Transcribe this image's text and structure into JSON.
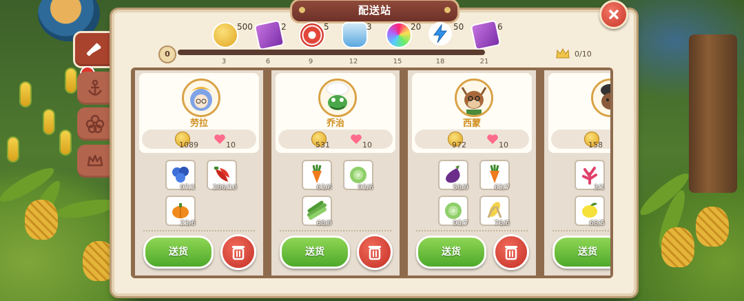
{
  "title": "配送站",
  "rewards": [
    {
      "icon": "gold-coin-icon",
      "count": "500",
      "tick": "3"
    },
    {
      "icon": "purple-ticket-icon",
      "count": "2",
      "tick": "6"
    },
    {
      "icon": "red-chip-icon",
      "count": "5",
      "tick": "9"
    },
    {
      "icon": "potion-bottle-icon",
      "count": "3",
      "tick": "12"
    },
    {
      "icon": "rainbow-orb-icon",
      "count": "20",
      "tick": "15"
    },
    {
      "icon": "lightning-icon",
      "count": "50",
      "tick": "18"
    },
    {
      "icon": "purple-ticket-icon",
      "count": "6",
      "tick": "21"
    }
  ],
  "progress": {
    "start": "0",
    "crown_progress": "0/10"
  },
  "customers": [
    {
      "name": "劳拉",
      "coins": "1089",
      "hearts": "10",
      "items": [
        {
          "icon": "blueberry-icon",
          "qty": "97/1"
        },
        {
          "icon": "chili-pepper-icon",
          "qty": "286/10"
        },
        {
          "icon": "pumpkin-icon",
          "qty": "23/6"
        }
      ],
      "send_label": "送货"
    },
    {
      "name": "乔治",
      "coins": "531",
      "hearts": "10",
      "items": [
        {
          "icon": "carrot-icon",
          "qty": "63/6"
        },
        {
          "icon": "cabbage-icon",
          "qty": "93/6"
        },
        {
          "icon": "bok-choy-icon",
          "qty": "68/9"
        }
      ],
      "send_label": "送货"
    },
    {
      "name": "西蒙",
      "coins": "972",
      "hearts": "10",
      "items": [
        {
          "icon": "eggplant-icon",
          "qty": "58/9"
        },
        {
          "icon": "carrot-icon",
          "qty": "63/7"
        },
        {
          "icon": "cabbage-icon",
          "qty": "93/7"
        },
        {
          "icon": "corn-icon",
          "qty": "76/6"
        }
      ],
      "send_label": "送货"
    },
    {
      "name": "",
      "coins": "158",
      "hearts": "",
      "items": [
        {
          "icon": "coral-icon",
          "qty": "3/1"
        },
        {
          "icon": "lemon-icon",
          "qty": "68/5"
        }
      ],
      "send_label": "送货"
    }
  ],
  "colors": {
    "accent_red": "#c9362a",
    "send_green": "#4ea92b",
    "panel_bg": "#f5ecd9",
    "name_gold": "#d08d1c"
  }
}
